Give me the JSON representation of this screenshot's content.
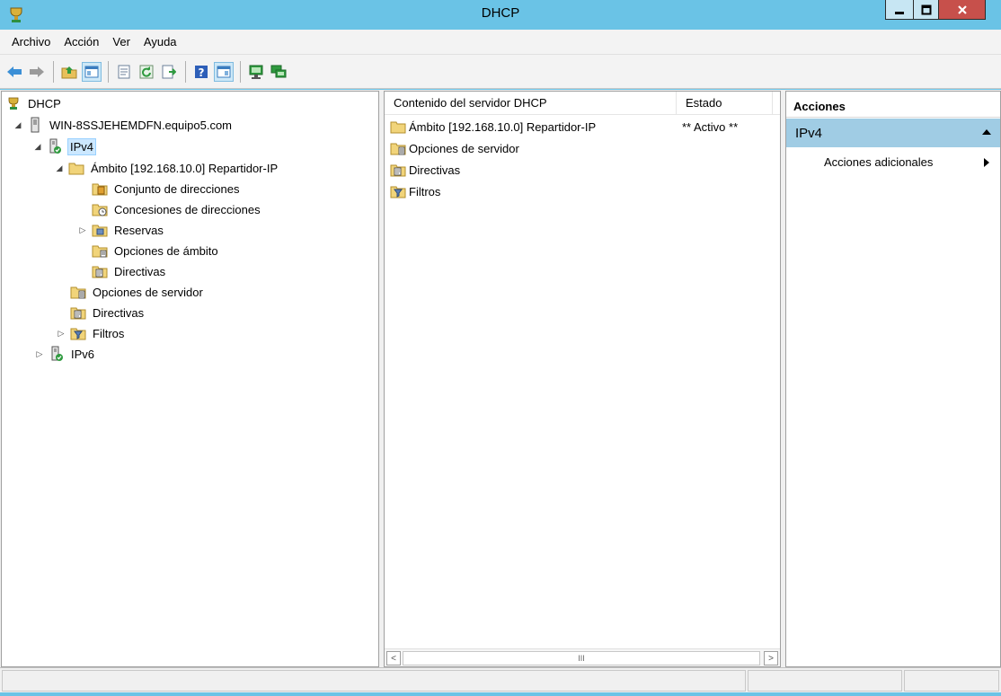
{
  "window": {
    "title": "DHCP"
  },
  "menu": [
    "Archivo",
    "Acción",
    "Ver",
    "Ayuda"
  ],
  "toolbar": {
    "icons": [
      "back-arrow-icon",
      "forward-arrow-icon",
      "up-folder-icon",
      "show-hide-tree-icon",
      "properties-icon",
      "refresh-icon",
      "export-list-icon",
      "help-icon",
      "show-hide-action-pane-icon",
      "server-icon",
      "add-server-icon"
    ]
  },
  "tree": {
    "root": "DHCP",
    "server": "WIN-8SSJEHEMDFN.equipo5.com",
    "ipv4": "IPv4",
    "scope": "Ámbito [192.168.10.0] Repartidor-IP",
    "address_pool": "Conjunto de direcciones",
    "address_leases": "Concesiones de direcciones",
    "reservations": "Reservas",
    "scope_options": "Opciones de ámbito",
    "scope_policies": "Directivas",
    "server_options": "Opciones de servidor",
    "policies": "Directivas",
    "filters": "Filtros",
    "ipv6": "IPv6"
  },
  "list": {
    "columns": [
      "Contenido del servidor DHCP",
      "Estado"
    ],
    "rows": [
      {
        "name": "Ámbito [192.168.10.0] Repartidor-IP",
        "state": "** Activo **",
        "icon": "folder-icon"
      },
      {
        "name": "Opciones de servidor",
        "state": "",
        "icon": "server-options-icon"
      },
      {
        "name": "Directivas",
        "state": "",
        "icon": "policies-icon"
      },
      {
        "name": "Filtros",
        "state": "",
        "icon": "filter-icon"
      }
    ],
    "scroll_thumb": "III"
  },
  "actions": {
    "header": "Acciones",
    "section": "IPv4",
    "item": "Acciones adicionales"
  },
  "colors": {
    "titlebar": "#6ac3e6",
    "selection": "#cce8ff",
    "actions_section": "#a0cce4",
    "close_button": "#c7504b"
  }
}
